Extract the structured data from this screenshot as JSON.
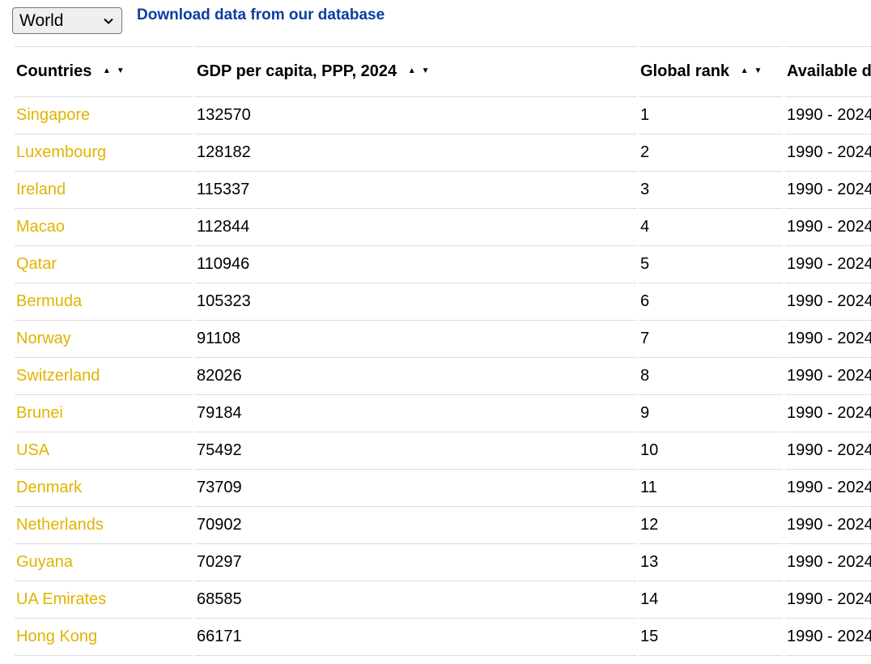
{
  "region_select": {
    "selected": "World"
  },
  "download_link": {
    "label": "Download data from our database"
  },
  "table": {
    "headers": {
      "countries": "Countries",
      "gdp": "GDP per capita, PPP, 2024",
      "rank": "Global rank",
      "available": "Available d"
    },
    "sort_up": "▲",
    "sort_down": "▼",
    "rows": [
      {
        "country": "Singapore",
        "value": "132570",
        "rank": "1",
        "available": "1990 - 2024"
      },
      {
        "country": "Luxembourg",
        "value": "128182",
        "rank": "2",
        "available": "1990 - 2024"
      },
      {
        "country": "Ireland",
        "value": "115337",
        "rank": "3",
        "available": "1990 - 2024"
      },
      {
        "country": "Macao",
        "value": "112844",
        "rank": "4",
        "available": "1990 - 2024"
      },
      {
        "country": "Qatar",
        "value": "110946",
        "rank": "5",
        "available": "1990 - 2024"
      },
      {
        "country": "Bermuda",
        "value": "105323",
        "rank": "6",
        "available": "1990 - 2024"
      },
      {
        "country": "Norway",
        "value": "91108",
        "rank": "7",
        "available": "1990 - 2024"
      },
      {
        "country": "Switzerland",
        "value": "82026",
        "rank": "8",
        "available": "1990 - 2024"
      },
      {
        "country": "Brunei",
        "value": "79184",
        "rank": "9",
        "available": "1990 - 2024"
      },
      {
        "country": "USA",
        "value": "75492",
        "rank": "10",
        "available": "1990 - 2024"
      },
      {
        "country": "Denmark",
        "value": "73709",
        "rank": "11",
        "available": "1990 - 2024"
      },
      {
        "country": "Netherlands",
        "value": "70902",
        "rank": "12",
        "available": "1990 - 2024"
      },
      {
        "country": "Guyana",
        "value": "70297",
        "rank": "13",
        "available": "1990 - 2024"
      },
      {
        "country": "UA Emirates",
        "value": "68585",
        "rank": "14",
        "available": "1990 - 2024"
      },
      {
        "country": "Hong Kong",
        "value": "66171",
        "rank": "15",
        "available": "1990 - 2024"
      }
    ]
  },
  "colors": {
    "link": "#0b3fa0",
    "country_link": "#e0b400",
    "row_border": "#dcdcdc"
  }
}
